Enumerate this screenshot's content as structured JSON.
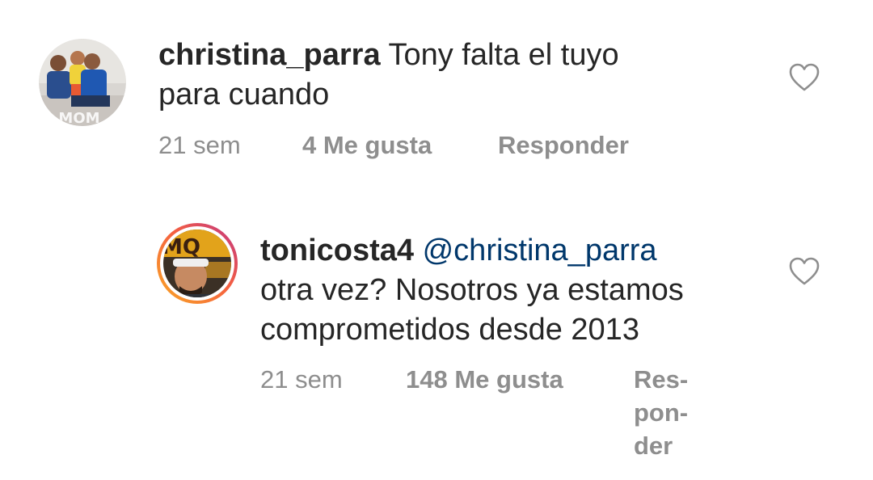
{
  "comments": [
    {
      "username": "christina_parra",
      "text_line1": "Tony falta el tuyo",
      "text_line2": "para cuando",
      "time": "21 sem",
      "likes": "4 Me gusta",
      "reply": "Responder",
      "avatar_watermark": "MOM",
      "heart_icon": "heart-outline-icon"
    },
    {
      "username": "tonicosta4",
      "mention": "@christina_parra",
      "text_line2": "otra vez? Nosotros ya estamos",
      "text_line3": "comprometidos desde 2013",
      "time": "21 sem",
      "likes": "148 Me gusta",
      "reply_parts": [
        "Res-",
        "pon-",
        "der"
      ],
      "avatar_logo": "MQ",
      "heart_icon": "heart-outline-icon"
    }
  ],
  "colors": {
    "text": "#262626",
    "muted": "#8e8e8e",
    "mention": "#00376b",
    "story_ring_start": "#f9a825",
    "story_ring_end": "#e1306c"
  }
}
